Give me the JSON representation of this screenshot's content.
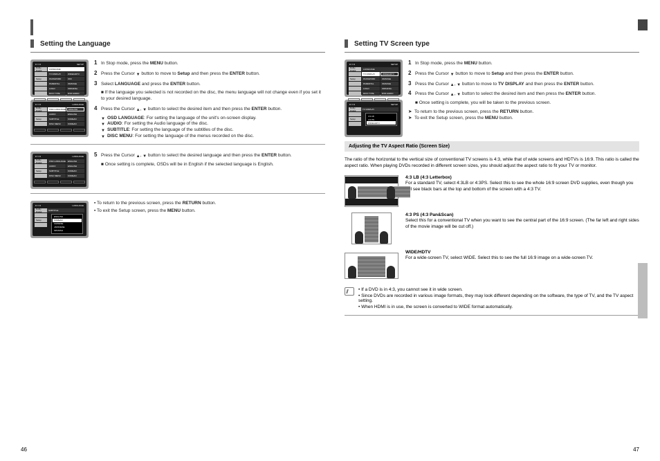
{
  "folio": {
    "left": "46",
    "right": "47"
  },
  "left": {
    "heading": "Setting the Language",
    "screens": {
      "setup": {
        "tl": "D V D",
        "tr": "SETUP",
        "rows": [
          {
            "tab": "Dolby Digital",
            "label": "LANGUAGE",
            "val": "",
            "labSel": true
          },
          {
            "tab": "",
            "label": "TV DISPLAY",
            "val": "WIDE/HDTV"
          },
          {
            "tab": "Setup",
            "label": "PASSWORD",
            "val": "OFF"
          },
          {
            "tab": "",
            "label": "PARENTAL",
            "val": "ORANGE"
          },
          {
            "tab": "",
            "label": "LOGO",
            "val": "ORIGINAL"
          },
          {
            "tab": "",
            "label": "DIVX TYPE",
            "val": "DVD AUDIO"
          }
        ]
      },
      "lang": {
        "tl": "D V D",
        "tr": "LANGUAGE",
        "rows": [
          {
            "tab": "Dolby Digital",
            "label": "OSD LANGUAGE",
            "val": "ENGLISH",
            "boxed": true,
            "labSel": true
          },
          {
            "tab": "",
            "label": "AUDIO",
            "val": "ENGLISH"
          },
          {
            "tab": "Setup",
            "label": "SUBTITLE",
            "val": "KOREAN"
          },
          {
            "tab": "",
            "label": "DISC MENU",
            "val": "KOREAN"
          }
        ]
      },
      "lang2": {
        "tl": "D V D",
        "tr": "LANGUAGE",
        "rows": [
          {
            "tab": "Dolby Digital",
            "label": "OSD LANGUAGE",
            "val": "ENGLISH"
          },
          {
            "tab": "",
            "label": "AUDIO",
            "val": "ENGLISH"
          },
          {
            "tab": "Setup",
            "label": "SUBTITLE",
            "val": "KOREAN"
          },
          {
            "tab": "",
            "label": "DISC MENU",
            "val": "KOREAN"
          }
        ]
      },
      "dropdown": {
        "tl": "D V D",
        "tr": "LANGUAGE",
        "side": [
          "Dolby Digital",
          "",
          "Setup",
          ""
        ],
        "label": "SUBTITLE",
        "options": [
          "ENGLISH",
          "KOREAN",
          "CHINESE",
          "JAPANESE",
          "SPANISH"
        ],
        "selected": 1
      }
    },
    "steps": {
      "s1": {
        "num": "1",
        "text_a": "In Stop mode, press the ",
        "btn": "MENU",
        "text_b": " button."
      },
      "s2": {
        "num": "2",
        "text_a": "Press the Cursor ",
        "text_b": " button to move to ",
        "kw": "Setup",
        "text_c": " and then press the ",
        "btn": "ENTER",
        "text_d": " button."
      },
      "s3": {
        "num": "3",
        "text_a": "Select ",
        "kw": "LANGUAGE",
        "text_b": " and press the ",
        "btn": "ENTER",
        "text_c": " button."
      },
      "sub3a": "If the language you selected is not recorded on the disc, the menu language will not change even if you set it to your desired language.",
      "s4": {
        "num": "4",
        "text_a": "Press the Cursor ",
        "text_b": " button to select the desired item and then press the ",
        "btn": "ENTER",
        "text_c": " button."
      },
      "osd": {
        "head": "OSD LANGUAGE",
        "body": ": For setting the language of the unit's on-screen display."
      },
      "audio": {
        "head": "AUDIO",
        "body": ": For setting the Audio language of the disc."
      },
      "subtitle": {
        "head": "SUBTITLE",
        "body": ": For setting the language of the subtitles of the disc."
      },
      "disc": {
        "head": "DISC MENU",
        "body": ": For setting the language of the menus recorded on the disc."
      },
      "s5": {
        "num": "5",
        "text_a": "Press the Cursor ",
        "text_b": " button to select the desired language and then press the ",
        "btn": "ENTER",
        "text_c": " button."
      },
      "note5": "Once setting is complete, OSDs will be in English if the selected language is English.",
      "exit_a": "To return to the previous screen, press the ",
      "exit_btn": "RETURN",
      "exit_b": " button.",
      "exit2_a": "To exit the Setup screen, press the ",
      "exit2_btn": "MENU",
      "exit2_b": " button."
    }
  },
  "right": {
    "heading": "Setting TV Screen type",
    "screens": {
      "setup": {
        "tl": "D V D",
        "tr": "SETUP",
        "rows": [
          {
            "tab": "Dolby Digital",
            "label": "LANGUAGE",
            "val": ""
          },
          {
            "tab": "",
            "label": "TV DISPLAY",
            "val": "WIDE/HDTV",
            "labSel": true,
            "boxed": true
          },
          {
            "tab": "Setup",
            "label": "PASSWORD",
            "val": "ORANGE"
          },
          {
            "tab": "",
            "label": "PARENTAL",
            "val": "ORANGE"
          },
          {
            "tab": "",
            "label": "LOGO",
            "val": "ORIGINAL"
          },
          {
            "tab": "",
            "label": "DIVX TYPE",
            "val": "DVD AUDIO"
          }
        ]
      },
      "dd": {
        "tl": "D V D",
        "tr": "SETUP",
        "side": [
          "Dolby Digital",
          "",
          "Setup",
          ""
        ],
        "label": "TV DISPLAY",
        "options": [
          "4:3 LB",
          "4:3 PS",
          "WIDE/HDTV"
        ],
        "selected": 2
      }
    },
    "steps": {
      "s1": {
        "num": "1",
        "text_a": "In Stop mode, press the ",
        "btn": "MENU",
        "text_b": " button."
      },
      "s2": {
        "num": "2",
        "text_a": "Press the Cursor ",
        "text_b": " button to move to ",
        "kw": "Setup",
        "text_c": " and then press the ",
        "btn": "ENTER",
        "text_d": " button."
      },
      "s3": {
        "num": "3",
        "text_a": "Press the Cursor ",
        "text_b": " button to move to ",
        "kw": "TV DISPLAY",
        "text_c": " and then press the ",
        "btn": "ENTER",
        "text_d": " button."
      },
      "s4": {
        "num": "4",
        "text_a": "Press the Cursor ",
        "text_b": " button to select the desired item and then press the ",
        "btn": "ENTER",
        "text_c": " button."
      },
      "note4": "Once setting is complete, you will be taken to the previous screen.",
      "exit1_a": "To return to the previous screen, press the ",
      "exit1_btn": "RETURN",
      "exit1_b": " button.",
      "exit2_a": "To exit the Setup screen, press the ",
      "exit2_btn": "MENU",
      "exit2_b": " button."
    },
    "band": "Adjusting the TV Aspect Ratio (Screen Size)",
    "band_sub": "The ratio of the horizontal to the vertical size of conventional TV screens is 4:3, while that of wide screens and HDTVs is 16:9. This ratio is called the aspect ratio. When playing DVDs recorded in different screen sizes, you should adjust the aspect ratio to fit your TV or monitor.",
    "ratios": [
      {
        "key": "lb",
        "title": "4:3 LB (4:3 Letterbox)",
        "body": "For a standard TV, select 4:3LB or 4:3PS. Select this to see the whole 16:9 screen DVD supplies, even though you will see black bars at the top and bottom of the screen with a 4:3 TV."
      },
      {
        "key": "ps",
        "title": "4:3 PS (4:3 Pan&Scan)",
        "body": "Select this for a conventional TV when you want to see the central part of the 16:9 screen. (The far left and right sides of the movie image will be cut off.)"
      },
      {
        "key": "wd",
        "title": "WIDE/HDTV",
        "body": "For a wide-screen TV, select WIDE. Select this to see the full 16:9 image on a wide-screen TV."
      }
    ],
    "notes": [
      "If a DVD is in 4:3, you cannot see it in wide screen.",
      "Since DVDs are recorded in various image formats, they may look different depending on the software, the type of TV, and the TV aspect setting.",
      "When HDMI is in use, the screen is converted to WIDE format automatically."
    ]
  }
}
